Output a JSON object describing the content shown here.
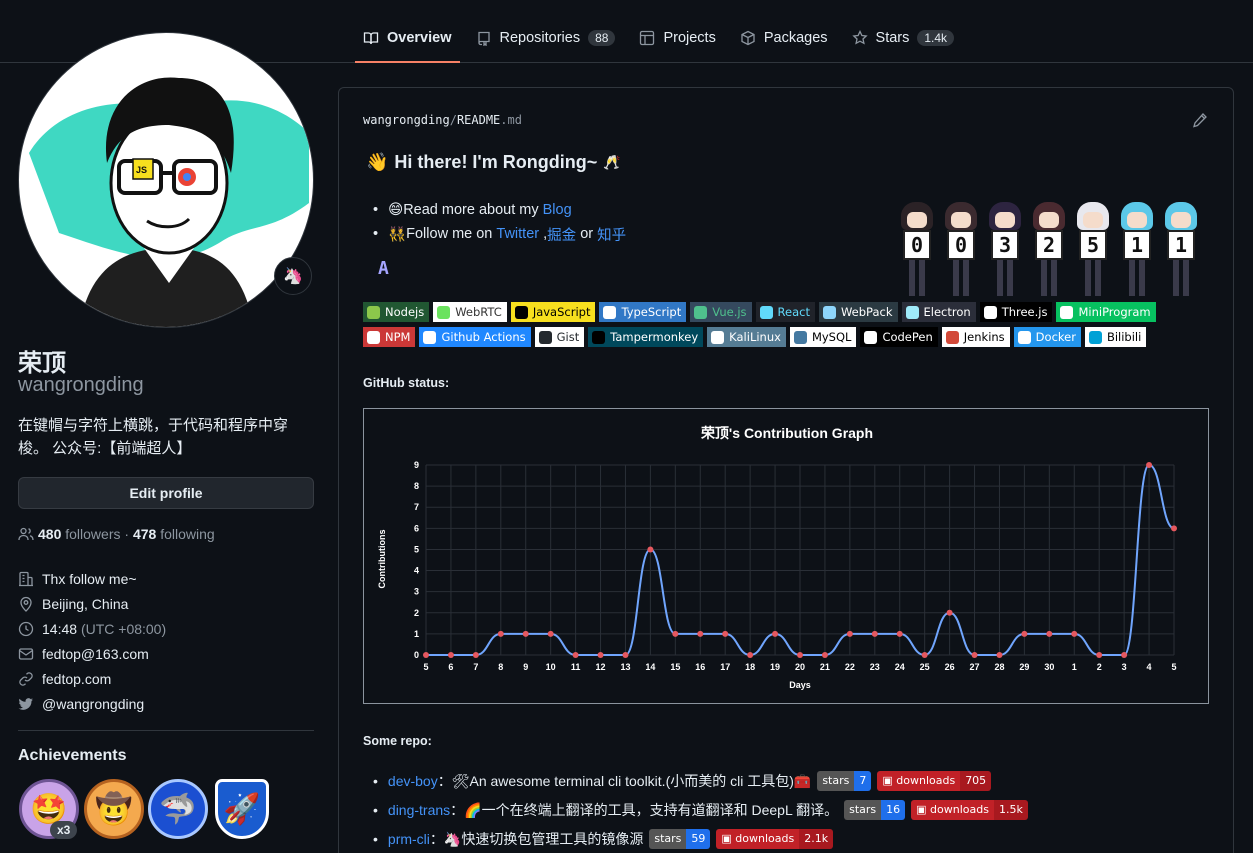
{
  "nav": {
    "tabs": [
      {
        "label": "Overview",
        "icon": "book-icon",
        "active": true
      },
      {
        "label": "Repositories",
        "icon": "repo-icon",
        "count": "88"
      },
      {
        "label": "Projects",
        "icon": "table-icon"
      },
      {
        "label": "Packages",
        "icon": "package-icon"
      },
      {
        "label": "Stars",
        "icon": "star-icon",
        "count": "1.4k"
      }
    ]
  },
  "profile": {
    "name": "荣顶",
    "login": "wangrongding",
    "bio": "在键帽与字符上横跳，于代码和程序中穿梭。 公众号:【前端超人】",
    "edit_label": "Edit profile",
    "followers_count": "480",
    "followers_label": "followers",
    "sep": "·",
    "following_count": "478",
    "following_label": "following",
    "company": "Thx follow me~",
    "location": "Beijing, China",
    "time": "14:48",
    "tz": "(UTC +08:00)",
    "email": "fedtop@163.com",
    "website": "fedtop.com",
    "twitter": "@wangrongding",
    "status_emoji": "🦄",
    "avatar_badges": {
      "js": "JS"
    }
  },
  "achievements": {
    "title": "Achievements",
    "count_label": "x3",
    "items": [
      "🤩",
      "🤠",
      "🦈",
      "🚀"
    ]
  },
  "readme": {
    "owner": "wangrongding",
    "slash": "/",
    "file": "README",
    "ext": ".md",
    "greeting_emoji": "👋",
    "greeting": "Hi there! I'm Rongding~",
    "greeting_tail": "🥂",
    "b1_emoji": "😄",
    "b1_text": "Read more about my ",
    "b1_link": "Blog",
    "b2_emoji": "👯",
    "b2_text": "Follow me on ",
    "b2_link1": "Twitter",
    "b2_sep": ",",
    "b2_link2": "掘金",
    "b2_or": " or ",
    "b2_link3": "知乎",
    "a_mark": "A",
    "counter_digits": [
      "0",
      "0",
      "3",
      "2",
      "5",
      "1",
      "1"
    ],
    "badges_row1": [
      {
        "label": "Nodejs",
        "bg": "#215732",
        "fg": "#ffffff",
        "ic": "#8cc84b"
      },
      {
        "label": "WebRTC",
        "bg": "#ffffff",
        "fg": "#333333",
        "ic": "#6be25f"
      },
      {
        "label": "JavaScript",
        "bg": "#f7df1e",
        "fg": "#000000",
        "ic": "#000000"
      },
      {
        "label": "TypeScript",
        "bg": "#3178c6",
        "fg": "#ffffff",
        "ic": "#ffffff"
      },
      {
        "label": "Vue.js",
        "bg": "#35495e",
        "fg": "#4fc08d",
        "ic": "#4fc08d"
      },
      {
        "label": "React",
        "bg": "#20232a",
        "fg": "#61dafb",
        "ic": "#61dafb"
      },
      {
        "label": "WebPack",
        "bg": "#2b3a42",
        "fg": "#ffffff",
        "ic": "#8ed6fb"
      },
      {
        "label": "Electron",
        "bg": "#2b2e3a",
        "fg": "#ffffff",
        "ic": "#9feaf9"
      },
      {
        "label": "Three.js",
        "bg": "#000000",
        "fg": "#ffffff",
        "ic": "#ffffff"
      },
      {
        "label": "MiniProgram",
        "bg": "#07c160",
        "fg": "#ffffff",
        "ic": "#ffffff"
      }
    ],
    "badges_row2": [
      {
        "label": "NPM",
        "bg": "#cb3837",
        "fg": "#ffffff",
        "ic": "#ffffff"
      },
      {
        "label": "Github Actions",
        "bg": "#2088ff",
        "fg": "#ffffff",
        "ic": "#ffffff"
      },
      {
        "label": "Gist",
        "bg": "#ffffff",
        "fg": "#24292e",
        "ic": "#24292e"
      },
      {
        "label": "Tampermonkey",
        "bg": "#00485b",
        "fg": "#ffffff",
        "ic": "#000000"
      },
      {
        "label": "KaliLinux",
        "bg": "#557c94",
        "fg": "#ffffff",
        "ic": "#ffffff"
      },
      {
        "label": "MySQL",
        "bg": "#ffffff",
        "fg": "#000000",
        "ic": "#4479a1"
      },
      {
        "label": "CodePen",
        "bg": "#000000",
        "fg": "#ffffff",
        "ic": "#ffffff"
      },
      {
        "label": "Jenkins",
        "bg": "#ffffff",
        "fg": "#000000",
        "ic": "#d24939"
      },
      {
        "label": "Docker",
        "bg": "#2496ed",
        "fg": "#ffffff",
        "ic": "#ffffff"
      },
      {
        "label": "Bilibili",
        "bg": "#ffffff",
        "fg": "#000000",
        "ic": "#00a1d6"
      }
    ],
    "github_status_label": "GitHub status:",
    "some_repo_label": "Some repo:",
    "repos": [
      {
        "name": "dev-boy",
        "desc": "：🛠An awesome terminal cli toolkit.(小而美的 cli 工具包)🧰",
        "stars": "7",
        "downloads": "705"
      },
      {
        "name": "ding-trans",
        "desc": "：🌈一个在终端上翻译的工具，支持有道翻译和 DeepL 翻译。",
        "stars": "16",
        "downloads": "1.5k"
      },
      {
        "name": "prm-cli",
        "desc": "：🦄快速切换包管理工具的镜像源",
        "stars": "59",
        "downloads": "2.1k"
      }
    ],
    "shield_stars": "stars",
    "shield_downloads": "downloads"
  },
  "chart_data": {
    "type": "line",
    "title": "荣顶's Contribution Graph",
    "xlabel": "Days",
    "ylabel": "Contributions",
    "ylim": [
      0,
      9
    ],
    "yticks": [
      0,
      1,
      2,
      3,
      4,
      5,
      6,
      7,
      8,
      9
    ],
    "x": [
      "5",
      "6",
      "7",
      "8",
      "9",
      "10",
      "11",
      "12",
      "13",
      "14",
      "15",
      "16",
      "17",
      "18",
      "19",
      "20",
      "21",
      "22",
      "23",
      "24",
      "25",
      "26",
      "27",
      "28",
      "29",
      "30",
      "1",
      "2",
      "3",
      "4",
      "5"
    ],
    "series": [
      {
        "values": [
          0,
          0,
          0,
          1,
          1,
          1,
          0,
          0,
          0,
          5,
          1,
          1,
          1,
          0,
          1,
          0,
          0,
          1,
          1,
          1,
          0,
          2,
          0,
          0,
          1,
          1,
          1,
          0,
          0,
          9,
          6
        ]
      }
    ],
    "grid": true,
    "line_color": "#70a5fd",
    "point_color": "#e5585f"
  }
}
